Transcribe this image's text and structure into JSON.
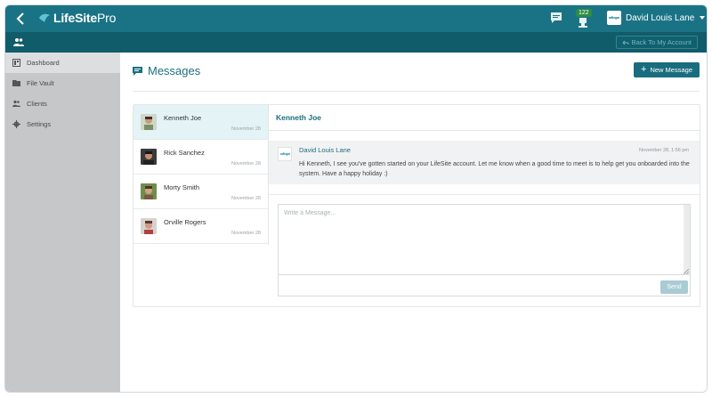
{
  "header": {
    "logo_text_bold": "LifeSite",
    "logo_text_light": "Pro",
    "back_icon": "chevron-left-icon",
    "chat_icon": "chat-bubble-icon",
    "notification_icon": "trophy-icon",
    "notification_count": "122",
    "user_name": "David Louis Lane",
    "accent_color": "#1a7385"
  },
  "subheader": {
    "icon": "people-icon",
    "back_to_account_label": "Back To My Account"
  },
  "sidebar": {
    "items": [
      {
        "label": "Dashboard",
        "icon": "dashboard-icon",
        "active": true
      },
      {
        "label": "File Vault",
        "icon": "folder-icon",
        "active": false
      },
      {
        "label": "Clients",
        "icon": "clients-icon",
        "active": false
      },
      {
        "label": "Settings",
        "icon": "gear-icon",
        "active": false
      }
    ]
  },
  "main": {
    "title": "Messages",
    "new_message_label": "New Message",
    "conversations": [
      {
        "name": "Kenneth Joe",
        "date": "November 28",
        "active": true
      },
      {
        "name": "Rick Sanchez",
        "date": "November 28",
        "active": false
      },
      {
        "name": "Morty Smith",
        "date": "November 28",
        "active": false
      },
      {
        "name": "Orville Rogers",
        "date": "November 28",
        "active": false
      }
    ],
    "thread": {
      "title": "Kenneth Joe",
      "message": {
        "from": "David Louis Lane",
        "date": "November 28, 1:56 pm",
        "body": "Hi Kenneth, I see you've gotten started on your LifeSite account. Let me know when a good time to meet is to help get you onboarded into the system. Have a happy holiday :)"
      },
      "compose_placeholder": "Write a Message...",
      "send_label": "Send"
    }
  }
}
